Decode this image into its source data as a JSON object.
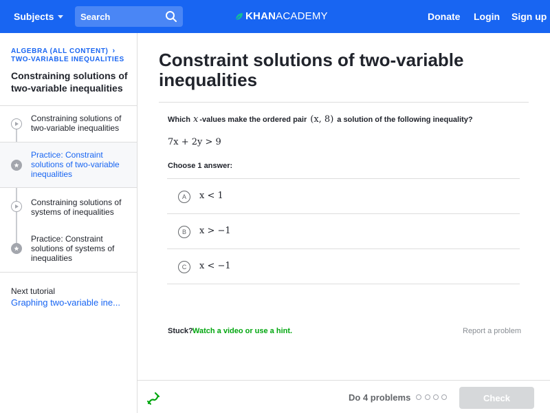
{
  "header": {
    "subjects_label": "Subjects",
    "search_placeholder": "Search",
    "brand_part1": "KHAN",
    "brand_part2": "ACADEMY",
    "donate_label": "Donate",
    "login_label": "Login",
    "signup_label": "Sign up"
  },
  "sidebar": {
    "breadcrumb_course": "ALGEBRA (ALL CONTENT)",
    "breadcrumb_unit": "TWO-VARIABLE INEQUALITIES",
    "unit_title": "Constraining solutions of two-variable inequalities",
    "items": [
      {
        "label": "Constraining solutions of two-variable inequalities",
        "icon": "play-icon",
        "active": false
      },
      {
        "label": "Practice: Constraint solutions of two-variable inequalities",
        "icon": "star-icon",
        "active": true
      },
      {
        "label": "Constraining solutions of systems of inequalities",
        "icon": "play-icon",
        "active": false
      },
      {
        "label": "Practice: Constraint solutions of systems of inequalities",
        "icon": "star-icon",
        "active": false
      }
    ],
    "next_tutorial_label": "Next tutorial",
    "next_tutorial_link": "Graphing two-variable ine..."
  },
  "exercise": {
    "title": "Constraint solutions of two-variable inequalities",
    "question_prefix": "Which",
    "question_var": "x",
    "question_mid": "-values make the ordered pair",
    "question_pair": "(x, 8)",
    "question_suffix": "a solution of the following inequality?",
    "inequality": "7x + 2y > 9",
    "choose_label": "Choose 1 answer:",
    "choices": [
      {
        "letter": "A",
        "text": "x < 1"
      },
      {
        "letter": "B",
        "text": "x > −1"
      },
      {
        "letter": "C",
        "text": "x < −1"
      }
    ],
    "stuck_label": "Stuck?",
    "hint_link": "Watch a video or use a hint.",
    "report_link": "Report a problem"
  },
  "footer": {
    "progress_label": "Do 4 problems",
    "problems_total": 4,
    "problems_done": 0,
    "check_label": "Check"
  },
  "colors": {
    "brand_blue": "#1865f2",
    "hint_green": "#00a60e",
    "disabled_gray": "#d6d8da"
  }
}
